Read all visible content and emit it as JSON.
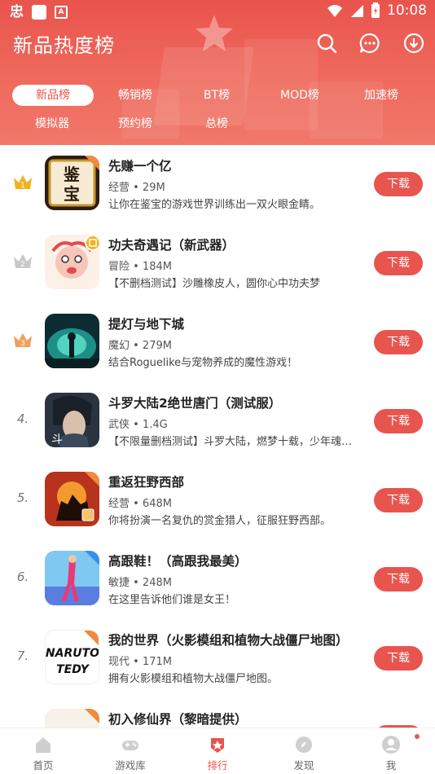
{
  "status_bar": {
    "left_glyph": "忠",
    "badge_letter": "A",
    "time": "10:08"
  },
  "header": {
    "title": "新品热度榜"
  },
  "tabs_row1": [
    "新品榜",
    "畅销榜",
    "BT榜",
    "MOD榜",
    "加速榜"
  ],
  "tabs_row2": [
    "模拟器",
    "预约榜",
    "总榜"
  ],
  "active_tab": "新品榜",
  "download_label": "下载",
  "games": [
    {
      "rank": "1",
      "name": "先赚一个亿",
      "meta": "经营 • 29M",
      "desc": "让你在鉴宝的游戏世界训练出一双火眼金睛。",
      "icon_text": "鉴宝",
      "badge": "ribbon"
    },
    {
      "rank": "2",
      "name": "功夫奇遇记（新武器）",
      "meta": "冒险 • 184M",
      "desc": "【不删档测试】沙雕橡皮人，圆你心中功夫梦",
      "badge": "dot"
    },
    {
      "rank": "3",
      "name": "提灯与地下城",
      "meta": "魔幻 • 279M",
      "desc": "结合Roguelike与宠物养成的魔性游戏！"
    },
    {
      "rank": "4.",
      "name": "斗罗大陆2绝世唐门（测试服）",
      "meta": "武侠 • 1.4G",
      "desc": "【不限量删档测试】斗罗大陆，燃梦十载，少年魂…"
    },
    {
      "rank": "5.",
      "name": "重返狂野西部",
      "meta": "经营 • 648M",
      "desc": "你将扮演一名复仇的赏金猎人，征服狂野西部。",
      "badge": "ribbon"
    },
    {
      "rank": "6.",
      "name": "高跟鞋！（高跟我最美）",
      "meta": "敏捷 • 248M",
      "desc": "在这里告诉他们谁是女王！",
      "badge": "ribbon-blue"
    },
    {
      "rank": "7.",
      "name": "我的世界（火影模组和植物大战僵尸地图）",
      "meta": "现代 • 171M",
      "desc": "拥有火影模组和植物大战僵尸地图。",
      "icon_text": "NARUTO TEDY",
      "badge": "ribbon"
    },
    {
      "rank": "",
      "name": "初入修仙界（黎暗提供）",
      "meta": "",
      "desc": "",
      "badge": "ribbon"
    }
  ],
  "bottom_nav": [
    {
      "label": "首页",
      "icon": "home-icon"
    },
    {
      "label": "游戏库",
      "icon": "gamepad-icon"
    },
    {
      "label": "排行",
      "icon": "ranking-icon"
    },
    {
      "label": "发现",
      "icon": "discover-icon"
    },
    {
      "label": "我",
      "icon": "profile-icon"
    }
  ],
  "active_nav": "排行",
  "colors": {
    "accent": "#e8554e",
    "header": "#ec5f55",
    "gold": "#f2b21f",
    "silver": "#c8c8c8",
    "bronze": "#f0a060"
  }
}
